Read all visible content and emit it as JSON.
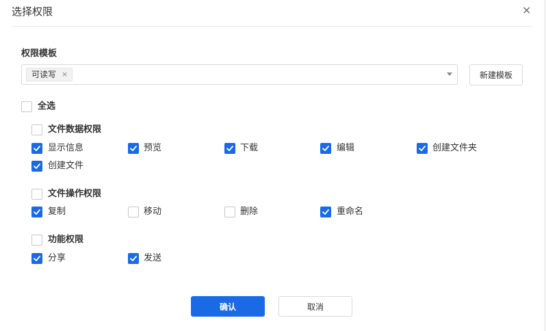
{
  "dialog": {
    "title": "选择权限",
    "close_glyph": "×"
  },
  "template": {
    "label": "权限模板",
    "selected_tag": "可读写",
    "tag_remove_glyph": "×",
    "new_button": "新建模板"
  },
  "select_all": {
    "label": "全选",
    "checked": false
  },
  "groups": [
    {
      "title": "文件数据权限",
      "checked": false,
      "items": [
        {
          "label": "显示信息",
          "checked": true
        },
        {
          "label": "预览",
          "checked": true
        },
        {
          "label": "下载",
          "checked": true
        },
        {
          "label": "编辑",
          "checked": true
        },
        {
          "label": "创建文件夹",
          "checked": true
        },
        {
          "label": "创建文件",
          "checked": true
        }
      ]
    },
    {
      "title": "文件操作权限",
      "checked": false,
      "items": [
        {
          "label": "复制",
          "checked": true
        },
        {
          "label": "移动",
          "checked": false
        },
        {
          "label": "删除",
          "checked": false
        },
        {
          "label": "重命名",
          "checked": true
        }
      ]
    },
    {
      "title": "功能权限",
      "checked": false,
      "items": [
        {
          "label": "分享",
          "checked": true
        },
        {
          "label": "发送",
          "checked": true
        }
      ]
    }
  ],
  "footer": {
    "confirm": "确认",
    "cancel": "取消"
  },
  "colors": {
    "accent": "#1a6ae6"
  }
}
